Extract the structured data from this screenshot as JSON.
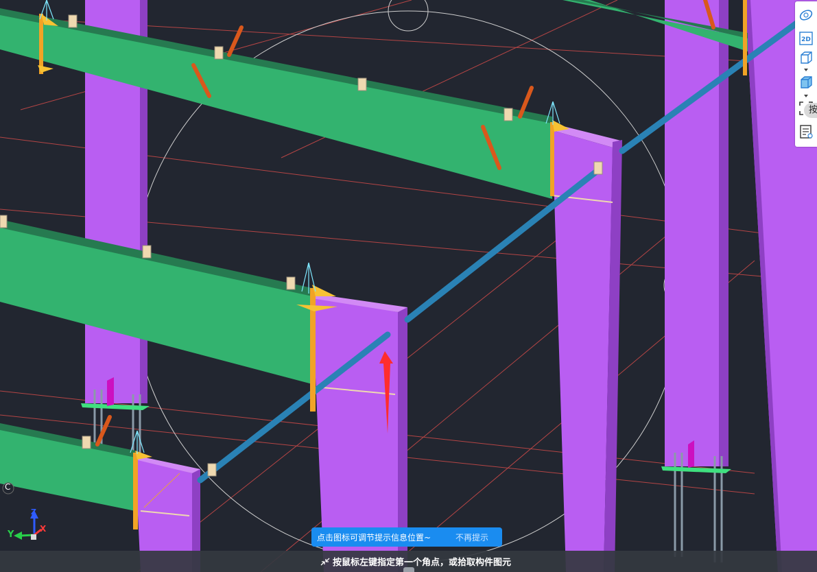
{
  "viewport": {
    "background": "#222630",
    "colors": {
      "column": "#b95ef2",
      "column_side": "#8e40c4",
      "beam": "#33b36f",
      "beam_side": "#267a50",
      "brace": "#2a82b5",
      "grid_line": "#b54545",
      "orbit_circle": "#cfcfcf",
      "purlin_tab": "#efd9b0",
      "tie_rod": "#d9581c",
      "stiffener": "#f1a326",
      "base_plate": "#3fe07f"
    }
  },
  "toolbar": {
    "items": [
      {
        "name": "orbit-icon"
      },
      {
        "name": "view-2d-icon",
        "label": "2D"
      },
      {
        "name": "wireframe-cube-icon"
      },
      {
        "name": "shaded-cube-icon"
      },
      {
        "name": "zoom-extents-icon"
      },
      {
        "name": "properties-icon"
      }
    ],
    "tooltip_text": "按"
  },
  "axis_triad": {
    "x": "X",
    "y": "Y",
    "z": "Z",
    "corner_label": "C"
  },
  "tip_banner": {
    "message": "点击图标可调节提示信息位置~",
    "dismiss": "不再提示"
  },
  "command_prompt": "按鼠标左键指定第一个角点，或拾取构件图元"
}
